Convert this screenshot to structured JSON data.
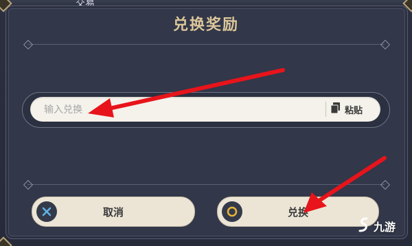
{
  "top_edge": {
    "text": "交易"
  },
  "dialog": {
    "title": "兑换奖励"
  },
  "redeem_field": {
    "placeholder": "输入兑换",
    "value": ""
  },
  "paste_button": {
    "label": "粘贴",
    "icon": "paste-icon"
  },
  "buttons": {
    "cancel": {
      "label": "取消",
      "icon": "close-icon"
    },
    "confirm": {
      "label": "兑换",
      "icon": "circle-icon"
    }
  },
  "watermark": {
    "text": "九游"
  },
  "colors": {
    "panel": "#323749",
    "title": "#dcc79a",
    "button_bg": "#ece5d6",
    "field_bg": "#f5f2ec",
    "arrow": "#e8141b"
  }
}
